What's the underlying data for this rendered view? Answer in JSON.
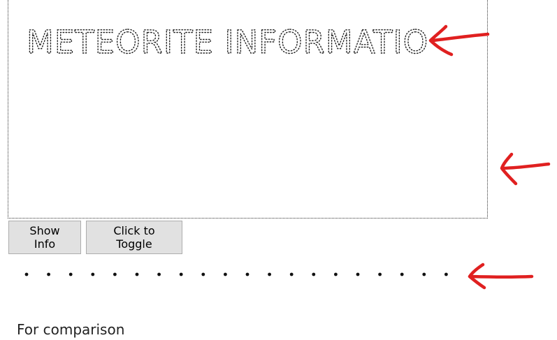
{
  "panel": {
    "title": "METEORITE INFORMATION"
  },
  "buttons": {
    "show_info": "Show Info",
    "toggle": "Click to Toggle"
  },
  "dots": {
    "count": 20
  },
  "comparison": {
    "label": "For comparison"
  },
  "annotations": {
    "arrow_color": "#e02020",
    "arrow_count": 3
  }
}
